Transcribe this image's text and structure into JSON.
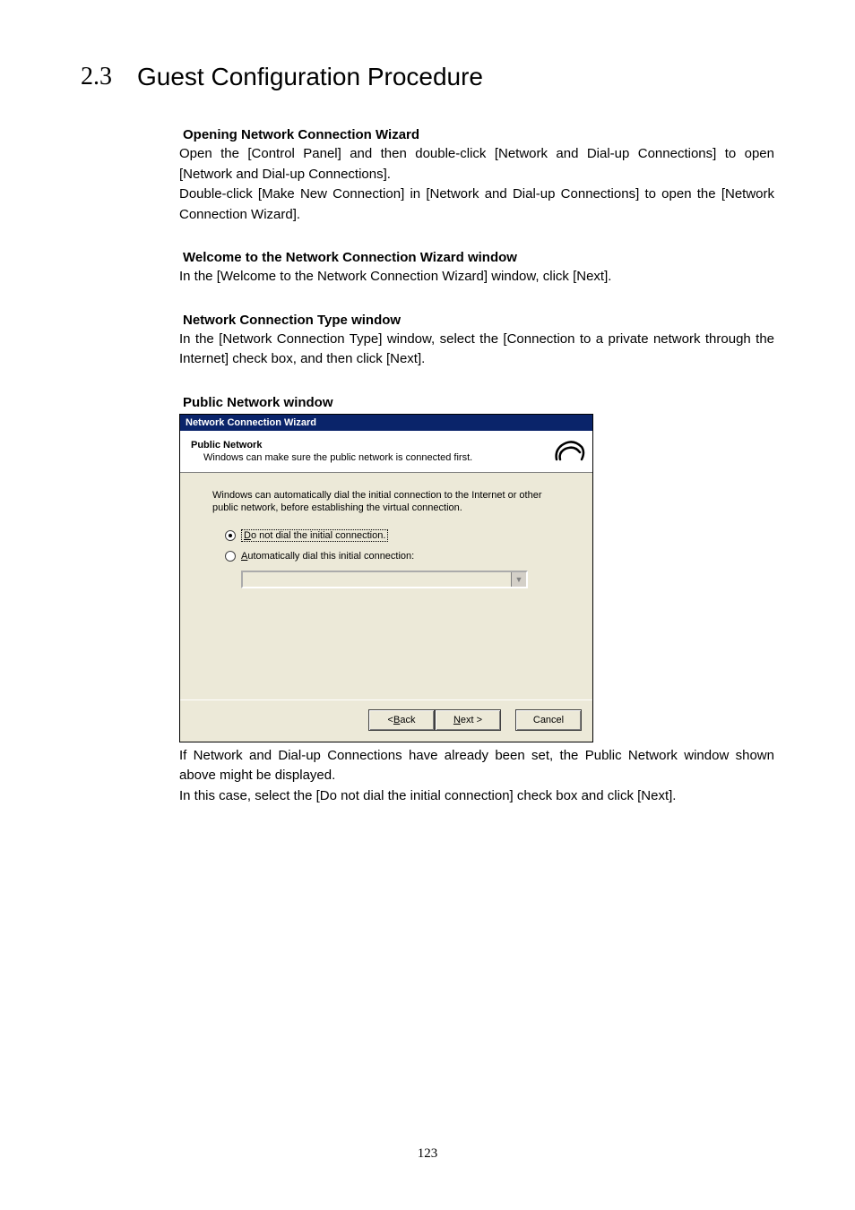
{
  "section": {
    "number": "2.3",
    "title": "Guest Configuration Procedure"
  },
  "s1": {
    "heading": "Opening Network Connection Wizard",
    "p1": "Open the [Control Panel] and then double-click [Network and Dial-up Connections] to open [Network and Dial-up Connections].",
    "p2": "Double-click [Make New Connection] in [Network and Dial-up Connections] to open the [Network Connection Wizard]."
  },
  "s2": {
    "heading": "Welcome to the Network Connection Wizard window",
    "p1": "In the [Welcome to the Network Connection Wizard] window, click [Next]."
  },
  "s3": {
    "heading": "Network Connection Type window",
    "p1": "In the [Network Connection Type] window, select the [Connection to a private network through the Internet] check box, and then click [Next]."
  },
  "s4": {
    "heading": "Public Network window"
  },
  "wizard": {
    "title": "Network Connection Wizard",
    "header_title": "Public Network",
    "header_sub": "Windows can make sure the public network is connected first.",
    "desc": "Windows can automatically dial the initial connection to the Internet or other public network, before establishing the virtual connection.",
    "radio1_prefix": "D",
    "radio1_rest": "o not dial the initial connection.",
    "radio2_prefix": "A",
    "radio2_rest": "utomatically dial this initial connection:",
    "back_prefix": "< ",
    "back_u": "B",
    "back_rest": "ack",
    "next_u": "N",
    "next_rest": "ext >",
    "cancel": "Cancel"
  },
  "after": {
    "p1": "If Network and Dial-up Connections have already been set, the Public Network window shown above might be displayed.",
    "p2": "In this case, select the [Do not dial the initial connection] check box and click [Next]."
  },
  "page_number": "123"
}
